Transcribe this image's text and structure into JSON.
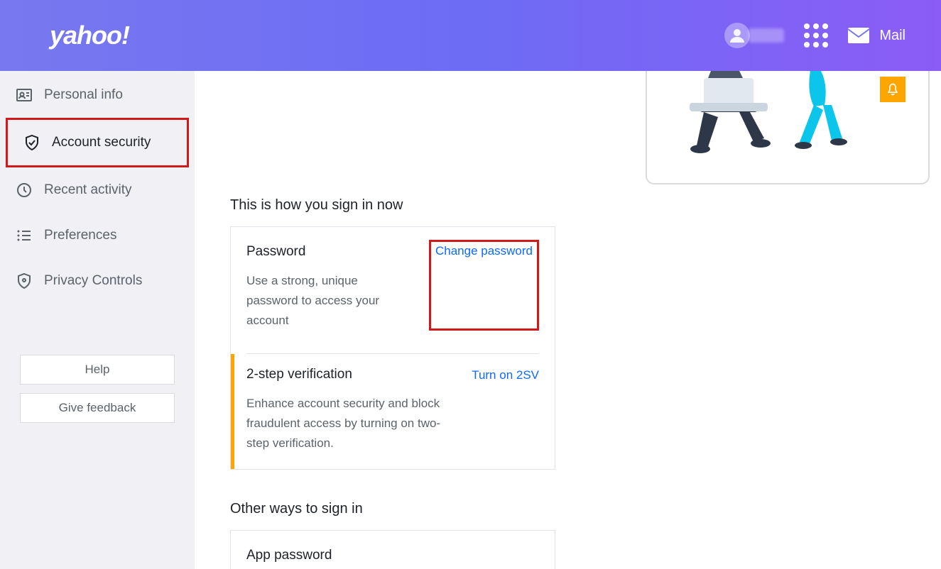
{
  "header": {
    "logo": "yahoo!",
    "mail_label": "Mail"
  },
  "sidebar": {
    "items": [
      {
        "label": "Personal info"
      },
      {
        "label": "Account security"
      },
      {
        "label": "Recent activity"
      },
      {
        "label": "Preferences"
      },
      {
        "label": "Privacy Controls"
      }
    ],
    "help_label": "Help",
    "feedback_label": "Give feedback"
  },
  "main": {
    "section1_heading": "This is how you sign in now",
    "password": {
      "title": "Password",
      "desc": "Use a strong, unique password to access your account",
      "link": "Change password"
    },
    "two_step": {
      "title": "2-step verification",
      "desc": "Enhance account security and block fraudulent access by turning on two-step verification.",
      "link": "Turn on 2SV"
    },
    "section2_heading": "Other ways to sign in",
    "app_password": {
      "title": "App password"
    }
  }
}
